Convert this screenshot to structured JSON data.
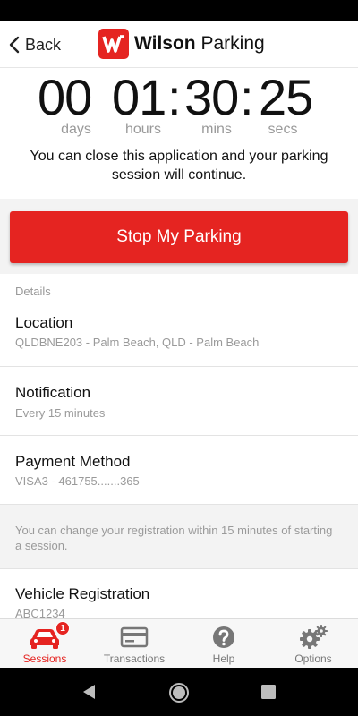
{
  "header": {
    "back_label": "Back",
    "brand_bold": "Wilson",
    "brand_regular": "Parking"
  },
  "timer": {
    "days": "00",
    "hours": "01",
    "mins": "30",
    "secs": "25",
    "sep1": ":",
    "sep2": ":",
    "days_label": "days",
    "hours_label": "hours",
    "mins_label": "mins",
    "secs_label": "secs",
    "note": "You can close this application and your parking session will continue."
  },
  "stop_button": {
    "label": "Stop My Parking"
  },
  "details": {
    "section_label": "Details",
    "location": {
      "title": "Location",
      "value": "QLDBNE203 - Palm Beach, QLD - Palm Beach"
    },
    "notification": {
      "title": "Notification",
      "value": "Every 15 minutes"
    },
    "payment": {
      "title": "Payment Method",
      "value": "VISA3 - 461755.......365"
    },
    "registration_note": "You can change your registration within 15 minutes of starting a session.",
    "vehicle": {
      "title": "Vehicle Registration",
      "value": "ABC1234"
    }
  },
  "tabbar": {
    "tabs": [
      {
        "label": "Sessions",
        "icon": "car-icon",
        "active": true,
        "badge": "1"
      },
      {
        "label": "Transactions",
        "icon": "credit-card-icon",
        "active": false
      },
      {
        "label": "Help",
        "icon": "help-icon",
        "active": false
      },
      {
        "label": "Options",
        "icon": "gears-icon",
        "active": false
      }
    ]
  },
  "colors": {
    "accent": "#e52421",
    "muted_text": "#9a9a9a",
    "section_bg": "#f3f3f3"
  }
}
